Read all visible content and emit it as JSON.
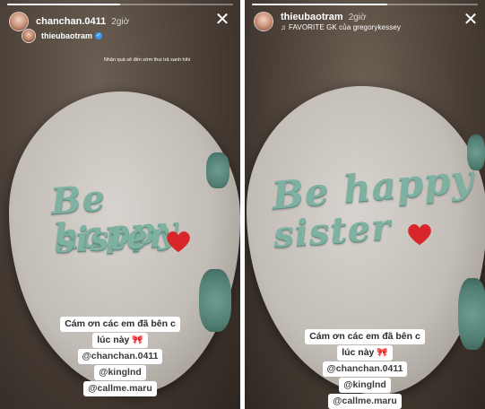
{
  "left_story": {
    "progress_fraction": 0.5,
    "header": {
      "username": "chanchan.0411",
      "time": "2giờ"
    },
    "reshared": {
      "username": "thieubaotram",
      "caption": "Nhận quà sẽ đến sớm thui trả xanh hihi"
    },
    "cake": {
      "line1": "Be happy",
      "line2": "sister"
    },
    "captions": [
      "Cám ơn các em đã bên c",
      "lúc này",
      "@chanchan.0411",
      "@kinglnd",
      "@callme.maru"
    ]
  },
  "right_story": {
    "progress_fraction": 0.6,
    "header": {
      "username": "thieubaotram",
      "time": "2giờ",
      "music": "FAVORITE GK của gregorykessey"
    },
    "cake": {
      "line1": "Be happy",
      "line2": "sister"
    },
    "captions": [
      "Cám ơn các em đã bên c",
      "lúc này",
      "@chanchan.0411",
      "@kinglnd",
      "@callme.maru"
    ]
  },
  "icons": {
    "close": "close-icon",
    "music": "music-note-icon",
    "verified": "verified-badge-icon",
    "bow": "bow-emoji-icon",
    "heart": "heart-icon"
  },
  "colors": {
    "frosting_text": "#7fb1a3",
    "heart": "#d8262a",
    "verified": "#3897f0"
  }
}
